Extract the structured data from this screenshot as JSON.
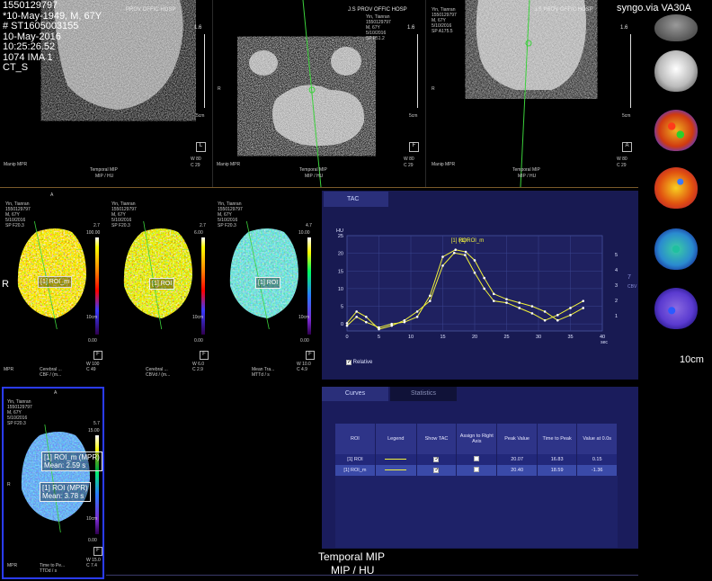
{
  "top_left": {
    "lines": [
      "1550129797",
      "*10-May-1949, M, 67Y",
      "# ST1605003155",
      "10-May-2016",
      "10:25:26.52",
      "1074 IMA 1",
      "CT_S"
    ],
    "hosp": "PROV OFFIC HOSP",
    "mid_scale": [
      "1.6",
      "5cm"
    ],
    "L_label": "L",
    "orient_r": "R",
    "wc": [
      "W  80",
      "C  29"
    ],
    "bottom": "Manip MPR",
    "bottom_center": [
      "Temporal MIP",
      "MIP / HU"
    ]
  },
  "top_mid": {
    "hosp": "J.S PROV OFFIC HOSP",
    "info": [
      "Yin, Tianran",
      "1550129797",
      "M, 67Y",
      "5/10/2016",
      "SP F51.2"
    ],
    "scale": [
      "1.6",
      "5cm"
    ],
    "orient_label": "F",
    "wc": [
      "W  80",
      "C  29"
    ],
    "bottom": "Manip MPR",
    "bottom_center": [
      "Temporal MIP",
      "MIP / HU"
    ],
    "orient_r": "R"
  },
  "top_right": {
    "hosp": "J.S PROV OFFIC HOSP",
    "info": [
      "Yin, Tianran",
      "1550129797",
      "M, 67Y",
      "5/10/2016",
      "SP A175.5"
    ],
    "scale": [
      "1.6",
      "5cm"
    ],
    "orient_label": "A",
    "wc": [
      "W  80",
      "C  29"
    ],
    "bottom": "Manip MPR",
    "bottom_center": [
      "Temporal MIP",
      "MIP / HU"
    ],
    "orient_r": "R"
  },
  "app_label": "syngo.via VA30A",
  "thumb_scale": "10cm",
  "viewports": [
    {
      "info": [
        "Yin, Tianran",
        "1550129797",
        "M, 67Y",
        "5/10/2016",
        "SP F20.3"
      ],
      "scale": [
        "2.7",
        "100.00",
        "0.00",
        "10cm"
      ],
      "orient": "F",
      "bottom": [
        "MPR",
        "Cerebral ...",
        "CBF / (m..."
      ],
      "wc": [
        "W  100",
        "C  49"
      ],
      "top": "A",
      "left": "R"
    },
    {
      "info": [
        "Yin, Tianran",
        "1550129797",
        "M, 67Y",
        "5/10/2016",
        "SP F20.3"
      ],
      "scale": [
        "2.7",
        "6.00",
        "0.00",
        "10cm"
      ],
      "orient": "F",
      "bottom": [
        "",
        "Cerebral ...",
        "CBVd / (m..."
      ],
      "wc": [
        "W  6.0",
        "C  2.9"
      ],
      "top": "",
      "left": ""
    },
    {
      "info": [
        "Yin, Tianran",
        "1550129797",
        "M, 67Y",
        "5/10/2016",
        "SP F20.3"
      ],
      "scale": [
        "4.7",
        "10.00",
        "0.00",
        "10cm"
      ],
      "orient": "F",
      "bottom": [
        "",
        "Mean Tra...",
        "MTTd / s"
      ],
      "wc": [
        "W  10.0",
        "C  4.9"
      ],
      "top": "",
      "left": ""
    },
    {
      "info": [
        "Yin, Tianran",
        "1550129797",
        "M, 67Y",
        "5/10/2016",
        "SP F20.3"
      ],
      "scale": [
        "5.7",
        "15.00",
        "0.00",
        "10cm"
      ],
      "orient": "F",
      "bottom": [
        "MPR",
        "Time to Pe...",
        "TTDd / s"
      ],
      "wc": [
        "W  15.0",
        "C  7.4"
      ],
      "top": "A",
      "left": "R"
    }
  ],
  "roi_labels": {
    "v1": "[1] ROI_m",
    "v2": "[1] ROI",
    "v3": "[1] ROI",
    "v4a_title": "[1] ROI_m (MPR)",
    "v4a_mean": "Mean: 2.59 s",
    "v4b_title": "[1] ROI (MPR)",
    "v4b_mean": "Mean: 3.78 s"
  },
  "tac": {
    "tab": "TAC",
    "relative": "Relative",
    "y_unit": "HU",
    "x_unit_label": "sec",
    "right_axis_title": "CBV",
    "right_axis_value": "7"
  },
  "chart_data": {
    "type": "line",
    "ylabel": "HU",
    "ylim": [
      -2,
      25
    ],
    "xlim": [
      0,
      40
    ],
    "x_ticks": [
      0,
      5,
      10,
      15,
      20,
      25,
      30,
      35,
      40
    ],
    "y_ticks": [
      0,
      5,
      10,
      15,
      20,
      25
    ],
    "y2_ticks": [
      1,
      2,
      3,
      4,
      5
    ],
    "legend_labels": [
      "[1] ROI",
      "[1] ROI_m"
    ],
    "series": [
      {
        "name": "[1] ROI",
        "color": "#f2f23a",
        "x": [
          0,
          1.5,
          3,
          5,
          7,
          9,
          11,
          13,
          15,
          16.8,
          18.5,
          20,
          21.5,
          23,
          25,
          27,
          29,
          31,
          33,
          35,
          37
        ],
        "y": [
          0.2,
          3.5,
          2.0,
          -1.5,
          -0.5,
          1.0,
          3.5,
          6.5,
          16.5,
          20.1,
          19.5,
          14.5,
          10.0,
          6.5,
          6.0,
          4.5,
          3.0,
          1.0,
          2.5,
          4.5,
          6.5
        ]
      },
      {
        "name": "[1] ROI_m",
        "color": "#f2f23a",
        "x": [
          0,
          1.5,
          3,
          5,
          7,
          9,
          11,
          13,
          15,
          17,
          18.6,
          20,
          21.5,
          23,
          25,
          27,
          29,
          31,
          33,
          35,
          37
        ],
        "y": [
          -0.5,
          2.0,
          0.5,
          -1.0,
          0.0,
          0.5,
          2.0,
          8.0,
          19.0,
          21.0,
          20.4,
          18.0,
          13.0,
          8.5,
          7.0,
          6.0,
          5.0,
          3.5,
          1.0,
          2.5,
          4.5
        ]
      }
    ]
  },
  "curves": {
    "tabs": [
      "Curves",
      "Statistics"
    ],
    "headers": [
      "ROI",
      "Legend",
      "Show TAC",
      "Assign to Right Axis",
      "Peak Value",
      "Time to Peak",
      "Value at 0.0s"
    ],
    "rows": [
      {
        "roi": "[1] ROI",
        "show": true,
        "assign": false,
        "peak": "20.07",
        "ttp": "16.83",
        "v0": "0.15"
      },
      {
        "roi": "[1] ROI_m",
        "show": true,
        "assign": false,
        "peak": "20.40",
        "ttp": "18.59",
        "v0": "-1.36"
      }
    ]
  },
  "bottom_caption": [
    "Temporal MIP",
    "MIP / HU"
  ],
  "colors": {
    "panel": "#181a52",
    "accent": "#f2f23a",
    "selected_border": "#2a3cff"
  }
}
